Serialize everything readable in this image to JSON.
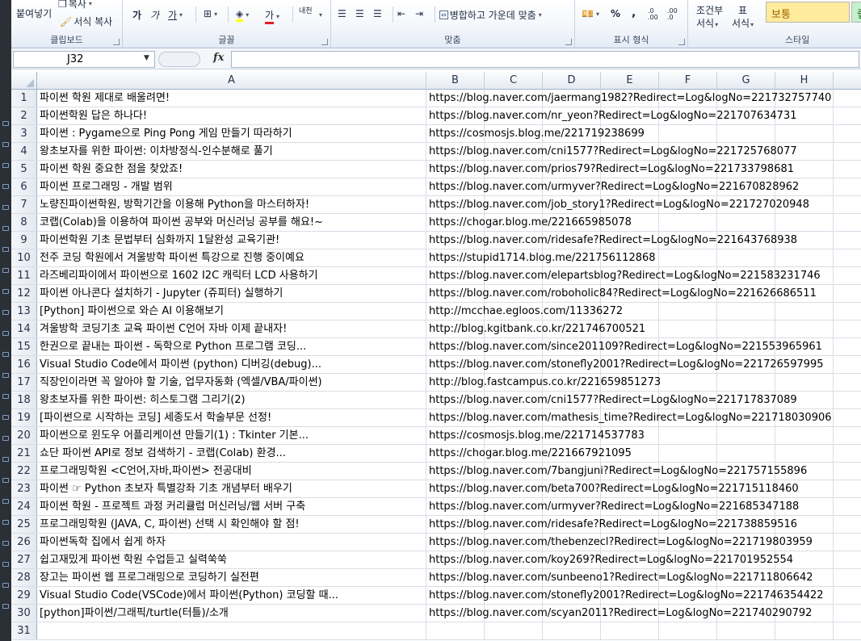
{
  "ribbon": {
    "clipboard": {
      "paste_label": "붙여넣기",
      "copy_label": "복사",
      "format_painter_label": "서식 복사",
      "group_label": "클립보드"
    },
    "font": {
      "group_label": "글꼴",
      "grow_label": "가",
      "shrink_label": "가",
      "phonetic_label": "가",
      "font_color_label": "가",
      "bold_hint": "",
      "wrap_label": "내천"
    },
    "alignment": {
      "group_label": "맞춤",
      "merge_label": "병합하고 가운데 맞춤"
    },
    "number": {
      "group_label": "표시 형식",
      "percent_label": "%",
      "comma_label": ",",
      "inc_dec_label": ".0 .00",
      "dec_dec_label": ".00 .0"
    },
    "styles": {
      "group_label": "스타일",
      "conditional_label": "조건부",
      "conditional_label2": "서식",
      "table_label": "표",
      "table_label2": "서식",
      "normal_label": "보통",
      "good_label": "좋음"
    }
  },
  "formula_bar": {
    "name_box": "J32",
    "fx": "fx",
    "formula": ""
  },
  "columns": [
    "A",
    "B",
    "C",
    "D",
    "E",
    "F",
    "G",
    "H"
  ],
  "rows": [
    {
      "n": "1",
      "a": "파이썬 학원 제대로 배울려면!",
      "b": "https://blog.naver.com/jaermang1982?Redirect=Log&logNo=221732757740"
    },
    {
      "n": "2",
      "a": "파이썬학원 답은 하나다!",
      "b": "https://blog.naver.com/nr_yeon?Redirect=Log&logNo=221707634731"
    },
    {
      "n": "3",
      "a": "파이썬 : Pygame으로 Ping Pong 게임 만들기 따라하기",
      "b": "https://cosmosjs.blog.me/221719238699"
    },
    {
      "n": "4",
      "a": "왕초보자를 위한 파이썬: 이차방정식-인수분해로 풀기",
      "b": "https://blog.naver.com/cni1577?Redirect=Log&logNo=221725768077"
    },
    {
      "n": "5",
      "a": "파이썬 학원 중요한 점을 찾았죠!",
      "b": "https://blog.naver.com/prios79?Redirect=Log&logNo=221733798681"
    },
    {
      "n": "6",
      "a": "파이썬 프로그래밍 - 개발 범위",
      "b": "https://blog.naver.com/urmyver?Redirect=Log&logNo=221670828962"
    },
    {
      "n": "7",
      "a": "노량진파이썬학원, 방학기간을 이용해 Python을 마스터하자!",
      "b": "https://blog.naver.com/job_story1?Redirect=Log&logNo=221727020948"
    },
    {
      "n": "8",
      "a": "코랩(Colab)을 이용하여 파이썬 공부와 머신러닝 공부를 해요!~",
      "b": "https://chogar.blog.me/221665985078"
    },
    {
      "n": "9",
      "a": "파이썬학원 기초 문법부터 심화까지 1달완성 교육기관!",
      "b": "https://blog.naver.com/ridesafe?Redirect=Log&logNo=221643768938"
    },
    {
      "n": "10",
      "a": "전주 코딩 학원에서 겨울방학 파이썬 특강으로 진행 중이예요",
      "b": "https://stupid1714.blog.me/221756112868"
    },
    {
      "n": "11",
      "a": "라즈베리파이에서 파이썬으로 1602 I2C 캐릭터 LCD 사용하기",
      "b": "https://blog.naver.com/elepartsblog?Redirect=Log&logNo=221583231746"
    },
    {
      "n": "12",
      "a": "파이썬 아나콘다 설치하기 - Jupyter (쥬피터) 실행하기",
      "b": "https://blog.naver.com/roboholic84?Redirect=Log&logNo=221626686511"
    },
    {
      "n": "13",
      "a": "[Python] 파이썬으로 와슨 AI 이용해보기",
      "b": "http://mcchae.egloos.com/11336272"
    },
    {
      "n": "14",
      "a": "겨울방학 코딩기초 교육 파이썬 C언어 자바 이제 끝내자!",
      "b": "http://blog.kgitbank.co.kr/221746700521"
    },
    {
      "n": "15",
      "a": "한권으로 끝내는 파이썬 - 독학으로 Python 프로그램 코딩...",
      "b": "https://blog.naver.com/since201109?Redirect=Log&logNo=221553965961"
    },
    {
      "n": "16",
      "a": "Visual Studio Code에서 파이썬 (python) 디버깅(debug)...",
      "b": "https://blog.naver.com/stonefly2001?Redirect=Log&logNo=221726597995"
    },
    {
      "n": "17",
      "a": "직장인이라면 꼭 알아야 할 기술, 업무자동화 (엑셀/VBA/파이썬)",
      "b": "http://blog.fastcampus.co.kr/221659851273"
    },
    {
      "n": "18",
      "a": "왕초보자를 위한 파이썬: 히스토그램 그리기(2)",
      "b": "https://blog.naver.com/cni1577?Redirect=Log&logNo=221717837089"
    },
    {
      "n": "19",
      "a": "[파이썬으로 시작하는 코딩] 세종도서 학술부문 선정!",
      "b": "https://blog.naver.com/mathesis_time?Redirect=Log&logNo=221718030906"
    },
    {
      "n": "20",
      "a": "파이썬으로 윈도우 어플리케이션 만들기(1) : Tkinter 기본...",
      "b": "https://cosmosjs.blog.me/221714537783"
    },
    {
      "n": "21",
      "a": "쇼단 파이썬 API로 정보 검색하기 - 코랩(Colab) 환경...",
      "b": "https://chogar.blog.me/221667921095"
    },
    {
      "n": "22",
      "a": "프로그래밍학원 <C언어,자바,파이썬> 전공대비",
      "b": "https://blog.naver.com/7bangjuni?Redirect=Log&logNo=221757155896"
    },
    {
      "n": "23",
      "a": "파이썬 ☞ Python 초보자 특별강좌 기초 개념부터 배우기",
      "b": "https://blog.naver.com/beta700?Redirect=Log&logNo=221715118460"
    },
    {
      "n": "24",
      "a": "파이썬 학원 - 프로젝트 과정 커리큘럼 머신러닝/웹 서버 구축",
      "b": "https://blog.naver.com/urmyver?Redirect=Log&logNo=221685347188"
    },
    {
      "n": "25",
      "a": "프로그래밍학원 (JAVA, C, 파이썬) 선택 시 확인해야 할 점!",
      "b": "https://blog.naver.com/ridesafe?Redirect=Log&logNo=221738859516"
    },
    {
      "n": "26",
      "a": "파이썬독학 집에서 쉽게 하자",
      "b": "https://blog.naver.com/thebenzecl?Redirect=Log&logNo=221719803959"
    },
    {
      "n": "27",
      "a": "쉽고재밌게 파이썬 학원 수업듣고 실력쑥쑥",
      "b": "https://blog.naver.com/koy269?Redirect=Log&logNo=221701952554"
    },
    {
      "n": "28",
      "a": "장고는 파이썬 웹 프로그래밍으로 코딩하기 실전편",
      "b": "https://blog.naver.com/sunbeeno1?Redirect=Log&logNo=221711806642"
    },
    {
      "n": "29",
      "a": "Visual Studio Code(VSCode)에서 파이썬(Python) 코딩할 때...",
      "b": "https://blog.naver.com/stonefly2001?Redirect=Log&logNo=221746354422"
    },
    {
      "n": "30",
      "a": "[python]파이썬/그래픽/turtle(터틀)/소개",
      "b": "https://blog.naver.com/scyan2011?Redirect=Log&logNo=221740290792"
    },
    {
      "n": "31",
      "a": "",
      "b": ""
    }
  ]
}
